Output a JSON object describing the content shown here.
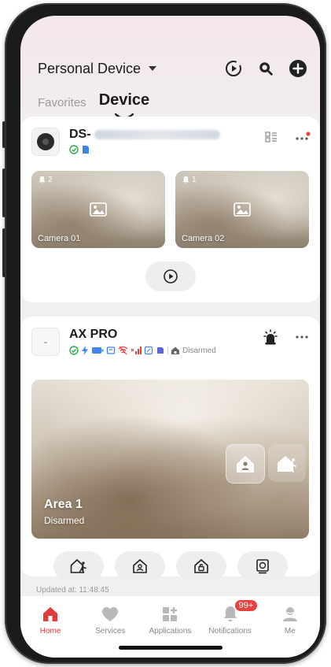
{
  "header": {
    "title": "Personal Device"
  },
  "tabs": [
    {
      "label": "Favorites"
    },
    {
      "label": "Device"
    }
  ],
  "device1": {
    "name": "DS-",
    "cameras": [
      {
        "label": "Camera 01",
        "alarm_count": "2"
      },
      {
        "label": "Camera 02",
        "alarm_count": "1"
      }
    ]
  },
  "device2": {
    "name": "AX PRO",
    "status": "Disarmed",
    "area": {
      "name": "Area 1",
      "status": "Disarmed"
    }
  },
  "updated": "Updated at: 11:48:45",
  "tabbar": {
    "items": [
      {
        "label": "Home"
      },
      {
        "label": "Services"
      },
      {
        "label": "Applications"
      },
      {
        "label": "Notifications",
        "badge": "99+"
      },
      {
        "label": "Me"
      }
    ]
  },
  "colors": {
    "accent": "#e23b3b",
    "badge": "#e84141"
  }
}
